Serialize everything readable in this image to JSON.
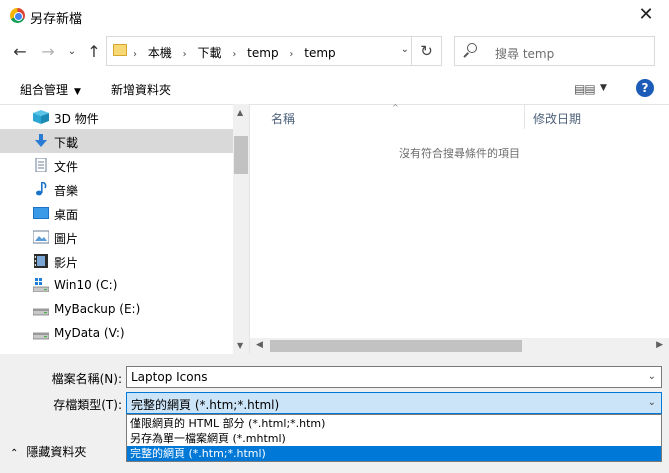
{
  "window": {
    "title": "另存新檔"
  },
  "address": {
    "crumbs": [
      "本機",
      "下載",
      "temp",
      "temp"
    ]
  },
  "search": {
    "placeholder": "搜尋 temp"
  },
  "toolbar": {
    "organize_label": "組合管理",
    "new_folder_label": "新增資料夾"
  },
  "sidebar": {
    "items": [
      {
        "label": "3D 物件",
        "icon": "cube-3d-icon"
      },
      {
        "label": "下載",
        "icon": "download-icon",
        "selected": true
      },
      {
        "label": "文件",
        "icon": "document-icon"
      },
      {
        "label": "音樂",
        "icon": "music-icon"
      },
      {
        "label": "桌面",
        "icon": "desktop-icon"
      },
      {
        "label": "圖片",
        "icon": "pictures-icon"
      },
      {
        "label": "影片",
        "icon": "videos-icon"
      },
      {
        "label": "Win10 (C:)",
        "icon": "drive-os-icon"
      },
      {
        "label": "MyBackup (E:)",
        "icon": "drive-icon"
      },
      {
        "label": "MyData (V:)",
        "icon": "drive-icon"
      }
    ]
  },
  "files": {
    "columns": {
      "name": "名稱",
      "date": "修改日期"
    },
    "empty_message": "沒有符合搜尋條件的項目"
  },
  "save": {
    "filename_label": "檔案名稱(N):",
    "filename_value": "Laptop Icons",
    "type_label": "存檔類型(T):",
    "type_value": "完整的網頁 (*.htm;*.html)",
    "type_options": [
      "僅限網頁的 HTML 部分 (*.html;*.htm)",
      "另存為單一檔案網頁 (*.mhtml)",
      "完整的網頁 (*.htm;*.html)"
    ],
    "selected_option_index": 2
  },
  "footer": {
    "hide_folders_label": "隱藏資料夾"
  },
  "colors": {
    "accent": "#0078d7",
    "selected_bg": "#cde8ff",
    "help": "#1c5bb8"
  }
}
